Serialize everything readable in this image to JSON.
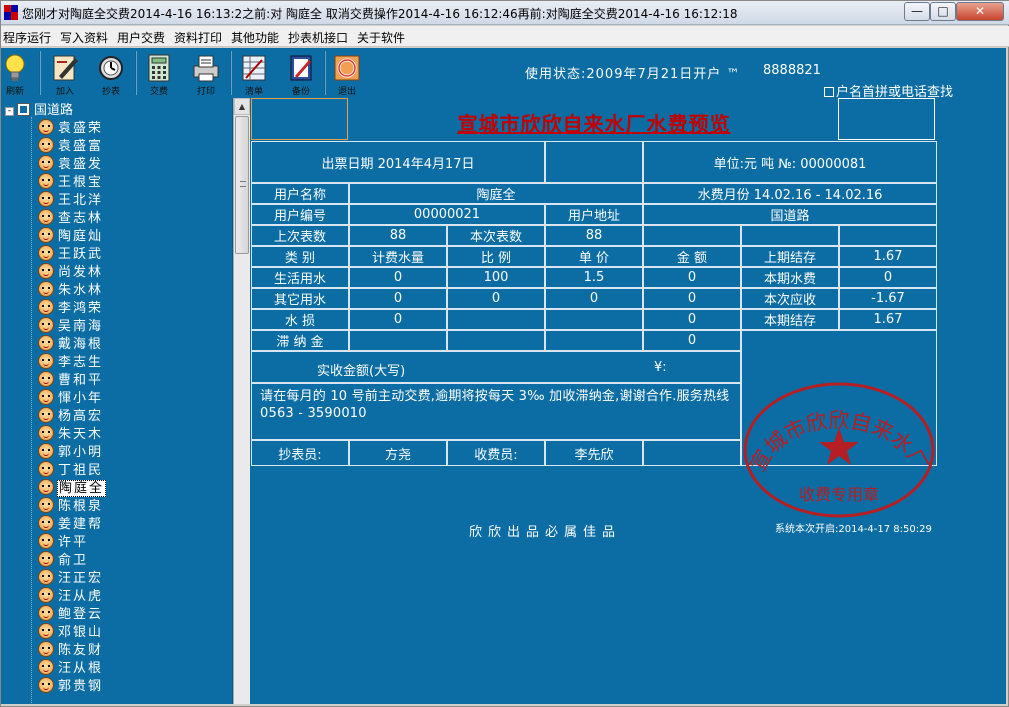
{
  "window": {
    "title": "您刚才对陶庭全交费2014-4-16 16:13:2之前:对 陶庭全 取消交费操作2014-4-16 16:12:46再前:对陶庭全交费2014-4-16 16:12:18",
    "min_glyph": "—",
    "max_glyph": "□",
    "close_glyph": "✕"
  },
  "menu": [
    "程序运行",
    "写入资料",
    "用户交费",
    "资料打印",
    "其他功能",
    "抄表机接口",
    "关于软件"
  ],
  "toolbar": {
    "buttons": [
      {
        "label": "刷新",
        "icon": "lightbulb-icon"
      },
      {
        "label": "加入",
        "icon": "pen-paper-icon"
      },
      {
        "label": "抄表",
        "icon": "meter-watch-icon"
      },
      {
        "label": "交费",
        "icon": "calculator-icon"
      },
      {
        "label": "打印",
        "icon": "printer-icon"
      },
      {
        "label": "清单",
        "icon": "list-grid-icon"
      },
      {
        "label": "备份",
        "icon": "notebook-pen-icon"
      },
      {
        "label": "退出",
        "icon": "exit-ring-icon"
      }
    ],
    "status_text": "使用状态:2009年7月21日开户 ™",
    "phone_text": "8888821",
    "search_toggle_label": "户名首拼或电话查找"
  },
  "tree": {
    "root": "国道路",
    "expand_glyph": "-",
    "selected": "陶庭全",
    "users": [
      "袁盛荣",
      "袁盛富",
      "袁盛发",
      "王根宝",
      "王北洋",
      "查志林",
      "陶庭灿",
      "王跃武",
      "尚发林",
      "朱水林",
      "李鸿荣",
      "吴南海",
      "戴海根",
      "李志生",
      "曹和平",
      "惲小年",
      "杨高宏",
      "朱天木",
      "郭小明",
      "丁祖民",
      "陶庭全",
      "陈根泉",
      "姜建帮",
      "许平",
      "俞卫",
      "汪正宏",
      "汪从虎",
      "鲍登云",
      "邓银山",
      "陈友财",
      "汪从根",
      "郭贵钢"
    ]
  },
  "invoice": {
    "title": "宣城市欣欣自来水厂水费预览",
    "issue_date": "出票日期 2014年4月17日",
    "unit_no": "单位:元 吨  №: 00000081",
    "labels": {
      "user_name": "用户名称",
      "user_no": "用户编号",
      "user_addr": "用户地址",
      "last_reading": "上次表数",
      "this_reading": "本次表数",
      "category": "类    别",
      "billing_qty": "计费水量",
      "ratio": "比    例",
      "unit_price": "单    价",
      "amount": "金    额",
      "prev_balance": "上期结存",
      "cur_fee": "本期水费",
      "due": "本次应收",
      "cur_balance": "本期结存",
      "living_water": "生活用水",
      "other_water": "其它用水",
      "water_loss": "水    损",
      "late_fee": "滞 纳 金",
      "actual_words": "实收金额(大写)",
      "yen": "¥:",
      "reader": "抄表员:",
      "collector": "收费员:"
    },
    "values": {
      "user_name": "陶庭全",
      "water_months": "水费月份 14.02.16 - 14.02.16",
      "user_no": "00000021",
      "user_addr": "国道路",
      "last_reading": "88",
      "this_reading": "88",
      "living_qty": "0",
      "living_ratio": "100",
      "living_price": "1.5",
      "living_amount": "0",
      "other_qty": "0",
      "other_ratio": "0",
      "other_price": "0",
      "other_amount": "0",
      "loss_qty": "0",
      "loss_amount": "0",
      "late_amount": "0",
      "prev_balance": "1.67",
      "cur_fee": "0",
      "due": "-1.67",
      "cur_balance": "1.67",
      "reader": "方尧",
      "collector": "李先欣"
    },
    "notice": "请在每月的 10 号前主动交费,逾期将按每天 3‰ 加收滞纳金,谢谢合作.服务热线0563 - 3590010",
    "stamp_text": "宣城市欣欣自来水厂",
    "stamp_sub": "收费专用章",
    "stamp_color": "#b51e22",
    "slogan": "欣欣出品必属佳品",
    "system_start": "系统本次开启:2014-4-17 8:50:29"
  },
  "colors": {
    "background": "#0b6da3",
    "title_red": "#c10000",
    "grid_line": "#d8e6f2"
  }
}
